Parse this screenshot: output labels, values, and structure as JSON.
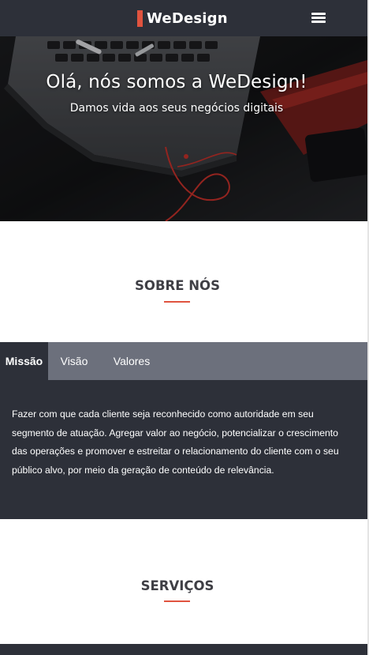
{
  "colors": {
    "accent": "#e0533f",
    "nav_bg": "#2d3039",
    "tabbar_bg": "#6c707c"
  },
  "header": {
    "brand_name": "WeDesign",
    "menu_icon": "hamburger-menu-icon"
  },
  "hero": {
    "title": "Olá, nós somos a WeDesign!",
    "subtitle": "Damos vida aos seus negócios digitais"
  },
  "about": {
    "heading": "SOBRE NÓS",
    "tabs": [
      {
        "label": "Missão",
        "active": true
      },
      {
        "label": "Visão",
        "active": false
      },
      {
        "label": "Valores",
        "active": false
      }
    ],
    "active_text": "Fazer com que cada cliente seja reconhecido como autoridade em seu segmento de atuação. Agregar valor ao negócio, potencializar o crescimento das operações e promover e estreitar o relacionamento do cliente com o seu público alvo, por meio da geração de conteúdo de relevância."
  },
  "services": {
    "heading": "SERVIÇOS"
  }
}
